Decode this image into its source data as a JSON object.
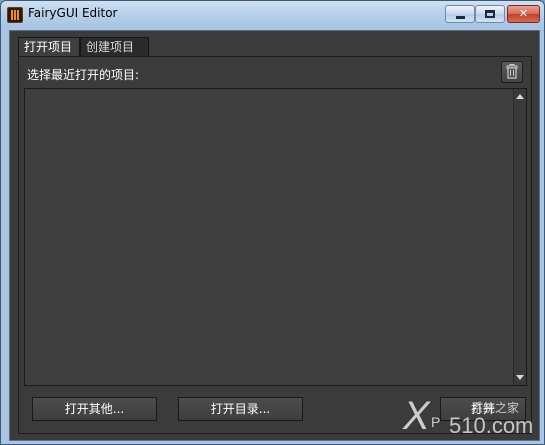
{
  "window": {
    "title": "FairyGUI Editor"
  },
  "tabs": [
    {
      "label": "打开项目",
      "active": true
    },
    {
      "label": "创建项目",
      "active": false
    }
  ],
  "panel": {
    "label": "选择最近打开的项目:",
    "recent_projects": []
  },
  "buttons": {
    "open_other": "打开其他...",
    "open_dir": "打开目录...",
    "third": "打开"
  },
  "watermark": {
    "text": "XP 510.com",
    "sub": "系统之家"
  },
  "colors": {
    "accent": "#f08a20",
    "panel_bg": "#3b3b3b",
    "text": "#ffffff"
  }
}
